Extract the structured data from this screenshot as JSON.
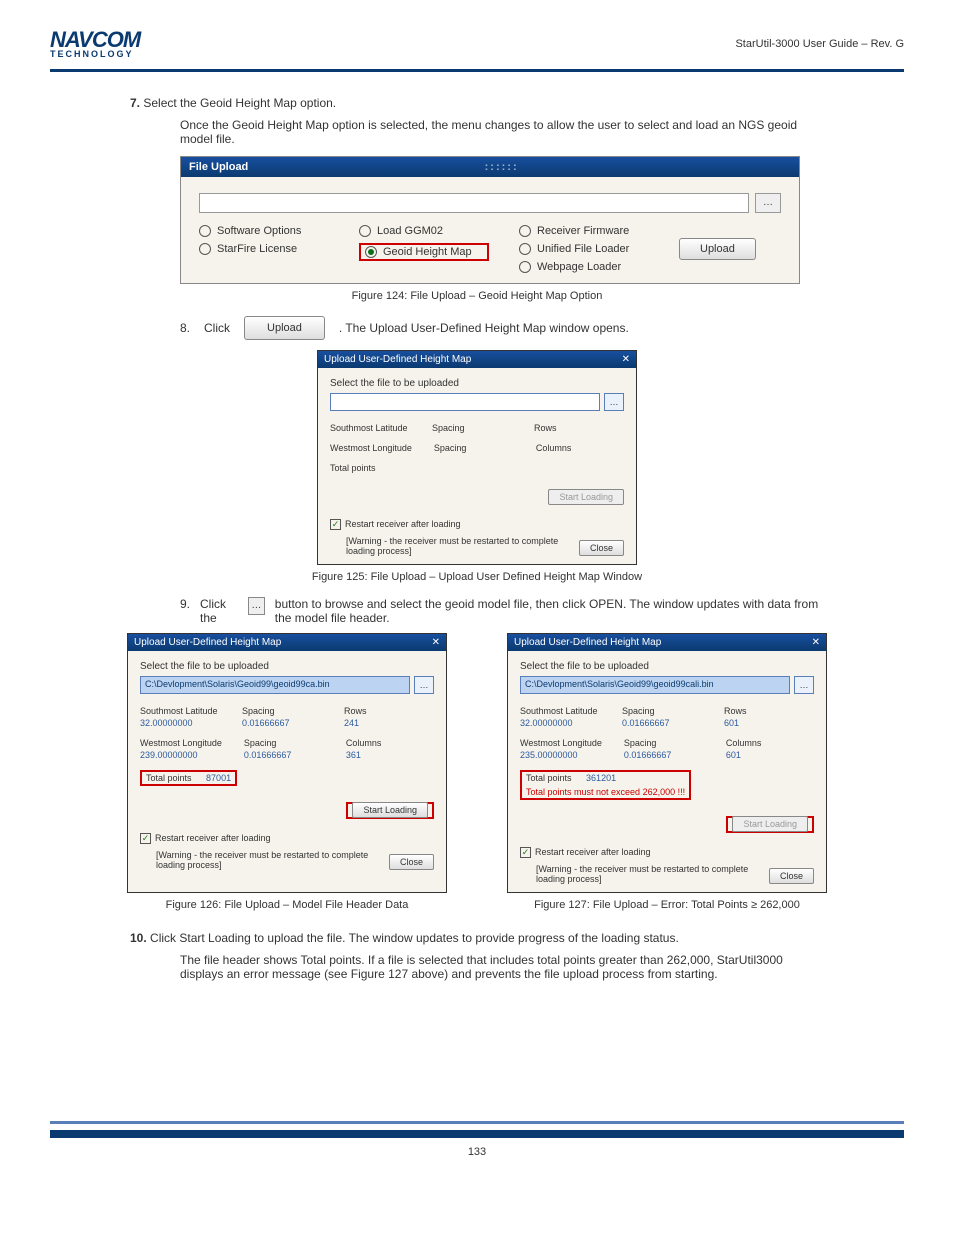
{
  "header": {
    "logo_main": "NAVCOM",
    "logo_sub": "TECHNOLOGY",
    "doc_title": "StarUtil-3000 User Guide – Rev. G"
  },
  "section": {
    "heading_num": "7.",
    "heading_text": "Select the Geoid Height Map option.",
    "body": "Once the Geoid Height Map option is selected, the menu changes to allow the user to select and load an NGS geoid model file."
  },
  "file_upload": {
    "title": "File Upload",
    "options_col1": [
      "Software Options",
      "StarFire License"
    ],
    "options_col2": [
      "Load GGM02",
      "Geoid Height Map"
    ],
    "options_col3": [
      "Receiver Firmware",
      "Unified File Loader",
      "Webpage Loader"
    ],
    "selected_option": "Geoid Height Map",
    "upload_label": "Upload"
  },
  "fig124_caption": "Figure 124: File Upload – Geoid Height Map Option",
  "step8": {
    "num": "8.",
    "text_before": "Click",
    "button_label": "Upload",
    "text_after": ". The Upload User-Defined Height Map window opens."
  },
  "dlg_blank": {
    "title": "Upload User-Defined Height Map",
    "select_label": "Select the file to be uploaded",
    "fields": {
      "southmost": "Southmost Latitude",
      "spacing": "Spacing",
      "rows": "Rows",
      "westmost": "Westmost Longitude",
      "columns": "Columns",
      "total_points": "Total points"
    },
    "start_loading": "Start Loading",
    "restart_label": "Restart receiver after loading",
    "warning": "[Warning - the receiver must be restarted to complete loading process]",
    "close_label": "Close"
  },
  "fig125_caption": "Figure 125: File Upload – Upload User Defined Height Map Window",
  "step9": {
    "num": "9.",
    "text_before": "Click the",
    "button_glyph": "…",
    "text_after": "button to browse and select the geoid model file, then click OPEN. The window updates with data from the model file header."
  },
  "dlg_left": {
    "file_path": "C:\\Devlopment\\Solaris\\Geoid99\\geoid99ca.bin",
    "southmost_val": "32.00000000",
    "spacing1_val": "0.01666667",
    "rows_val": "241",
    "westmost_val": "239.00000000",
    "spacing2_val": "0.01666667",
    "columns_val": "361",
    "total_points_label": "Total points",
    "total_points_val": "87001"
  },
  "dlg_right": {
    "file_path": "C:\\Devlopment\\Solaris\\Geoid99\\geoid99cali.bin",
    "southmost_val": "32.00000000",
    "spacing1_val": "0.01666667",
    "rows_val": "601",
    "westmost_val": "235.00000000",
    "spacing2_val": "0.01666667",
    "columns_val": "601",
    "total_points_label": "Total points",
    "total_points_val": "361201",
    "error_msg": "Total points must not exceed 262,000 !!!"
  },
  "fig126_caption": "Figure 126: File Upload – Model File Header Data",
  "fig127_caption": "Figure 127: File Upload – Error: Total Points ≥ 262,000",
  "step10": {
    "num": "10.",
    "text": "Click Start Loading to upload the file. The window updates to provide progress of the loading status."
  },
  "step10_note": "The file header shows Total points. If a file is selected that includes total points greater than 262,000, StarUtil3000 displays an error message (see Figure 127 above) and prevents the file upload process from starting.",
  "footer_page": "133"
}
